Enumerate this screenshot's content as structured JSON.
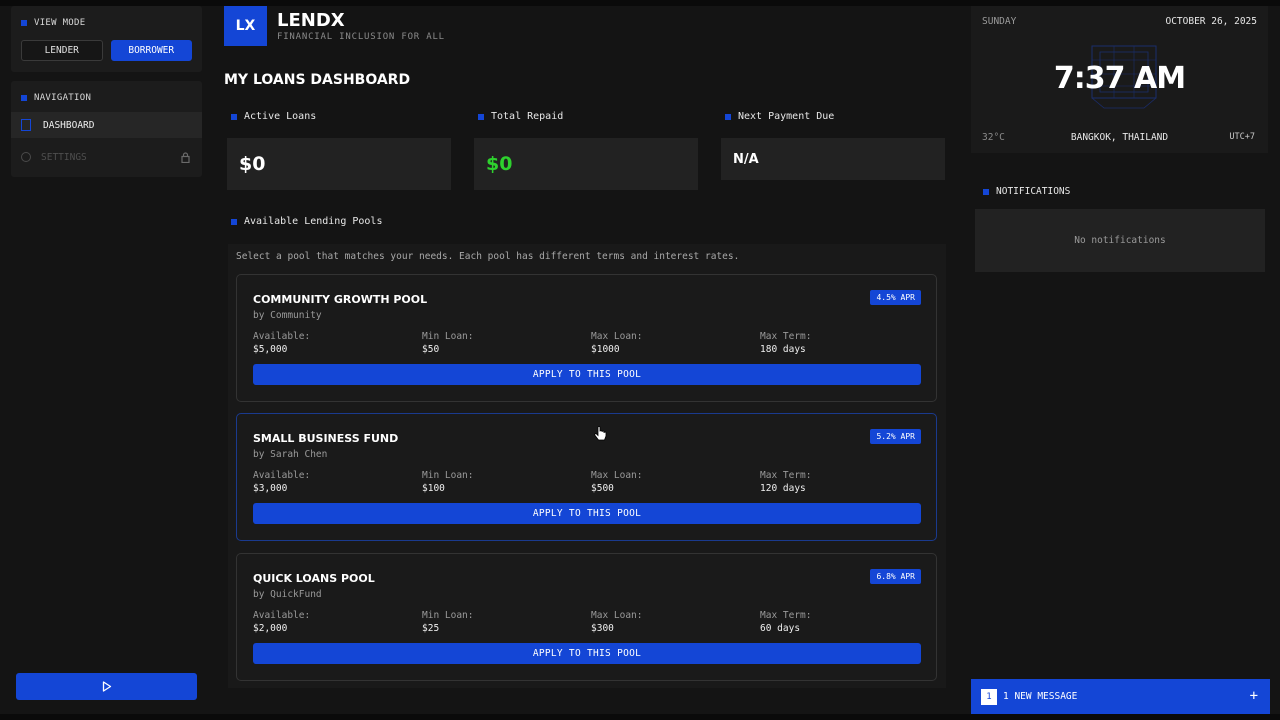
{
  "sidebar": {
    "view_mode_title": "VIEW MODE",
    "lender_label": "LENDER",
    "borrower_label": "BORROWER",
    "navigation_title": "NAVIGATION",
    "nav_items": [
      {
        "label": "DASHBOARD",
        "state": "selected"
      },
      {
        "label": "SETTINGS",
        "state": "disabled"
      }
    ]
  },
  "header": {
    "logo_text": "LX",
    "brand": "LENDX",
    "tagline": "FINANCIAL INCLUSION FOR ALL",
    "page_title": "MY LOANS DASHBOARD"
  },
  "stats": [
    {
      "label": "Active Loans",
      "value": "$0",
      "color": "#ffffff"
    },
    {
      "label": "Total Repaid",
      "value": "$0",
      "color": "#2ed12e"
    },
    {
      "label": "Next Payment Due",
      "value": "N/A",
      "color": "#ffffff"
    }
  ],
  "pools_section": {
    "title": "Available Lending Pools",
    "description": "Select a pool that matches your needs. Each pool has different terms and interest rates.",
    "field_labels": {
      "available": "Available:",
      "min": "Min Loan:",
      "max": "Max Loan:",
      "term": "Max Term:"
    },
    "apply_label": "APPLY TO THIS POOL",
    "pools": [
      {
        "name": "COMMUNITY GROWTH POOL",
        "by": "by Community",
        "apr": "4.5% APR",
        "available": "$5,000",
        "min": "$50",
        "max": "$1000",
        "term": "180 days"
      },
      {
        "name": "SMALL BUSINESS FUND",
        "by": "by Sarah Chen",
        "apr": "5.2% APR",
        "available": "$3,000",
        "min": "$100",
        "max": "$500",
        "term": "120 days"
      },
      {
        "name": "QUICK LOANS POOL",
        "by": "by QuickFund",
        "apr": "6.8% APR",
        "available": "$2,000",
        "min": "$25",
        "max": "$300",
        "term": "60 days"
      }
    ]
  },
  "clock": {
    "day": "SUNDAY",
    "date": "OCTOBER 26, 2025",
    "time": "7:37 AM",
    "temperature": "32°C",
    "location": "BANGKOK, THAILAND",
    "timezone": "UTC+7"
  },
  "notifications": {
    "title": "NOTIFICATIONS",
    "empty_text": "No notifications"
  },
  "message_bar": {
    "count": "1",
    "label": "1 NEW MESSAGE"
  },
  "colors": {
    "accent": "#1446d6",
    "positive": "#2ed12e",
    "background": "#141414"
  }
}
